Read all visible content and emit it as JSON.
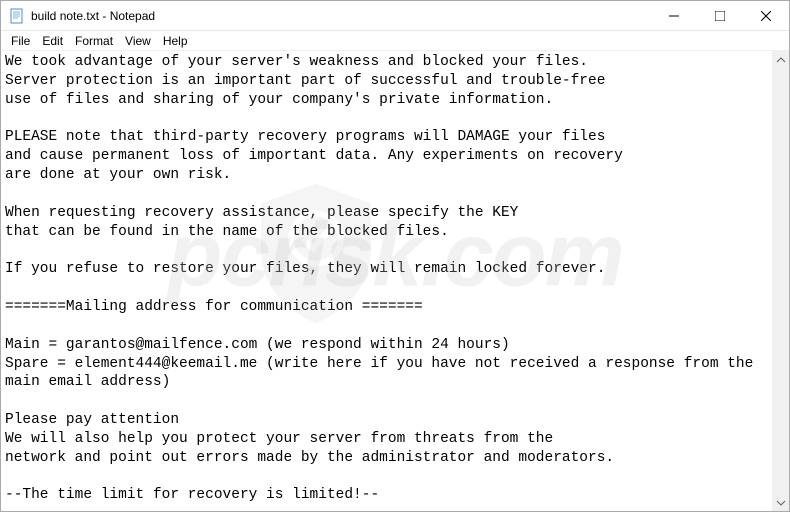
{
  "titlebar": {
    "title": "build note.txt - Notepad"
  },
  "menubar": {
    "items": [
      {
        "label": "File"
      },
      {
        "label": "Edit"
      },
      {
        "label": "Format"
      },
      {
        "label": "View"
      },
      {
        "label": "Help"
      }
    ]
  },
  "content": {
    "text": "We took advantage of your server's weakness and blocked your files.\nServer protection is an important part of successful and trouble-free\nuse of files and sharing of your company's private information.\n\nPLEASE note that third-party recovery programs will DAMAGE your files\nand cause permanent loss of important data. Any experiments on recovery\nare done at your own risk.\n\nWhen requesting recovery assistance, please specify the KEY\nthat can be found in the name of the blocked files.\n\nIf you refuse to restore your files, they will remain locked forever.\n\n=======Mailing address for communication =======\n\nMain = garantos@mailfence.com (we respond within 24 hours)\nSpare = element444@keemail.me (write here if you have not received a response from the main email address)\n\nPlease pay attention\nWe will also help you protect your server from threats from the\nnetwork and point out errors made by the administrator and moderators.\n\n--The time limit for recovery is limited!--"
  },
  "watermark": {
    "text": "pcrisk.com"
  }
}
